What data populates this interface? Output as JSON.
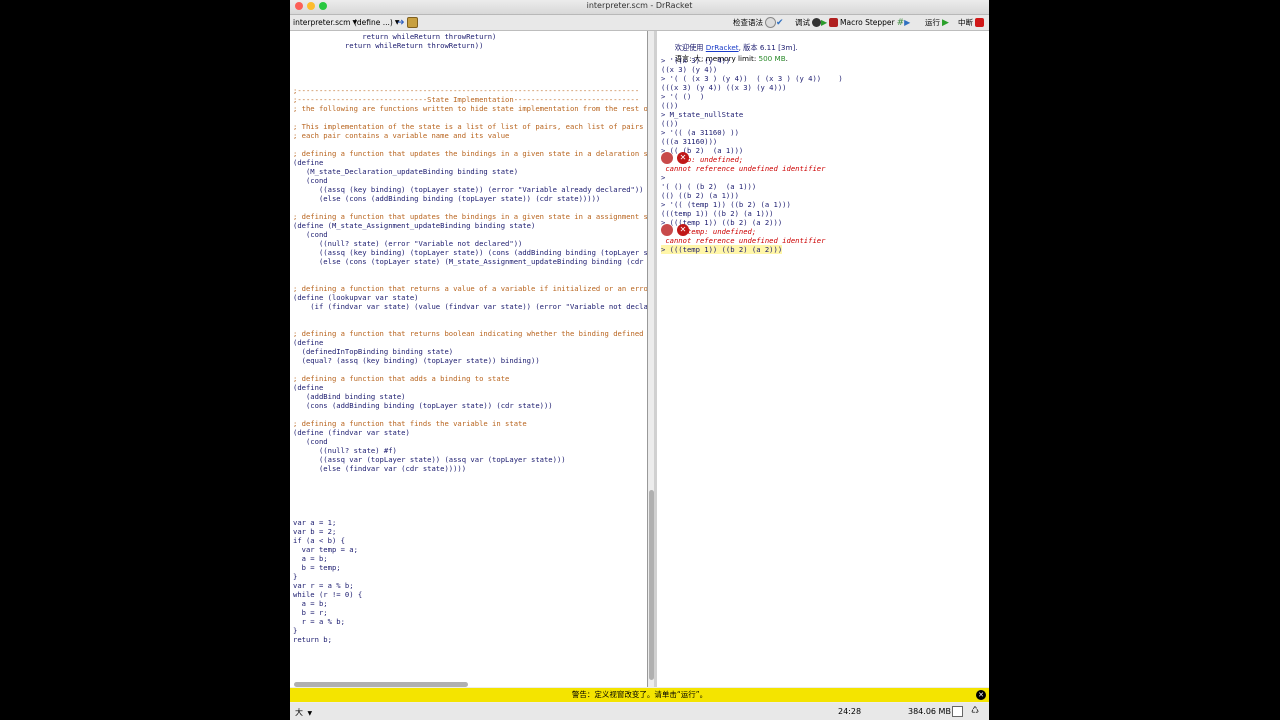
{
  "window": {
    "title": "interpreter.scm - DrRacket"
  },
  "toolbar": {
    "file_menu": "interpreter.scm",
    "define_menu": "(define ...)",
    "check_syntax": "检查语法",
    "debug": "调试",
    "macro_stepper": "Macro Stepper",
    "run": "运行",
    "stop": "中断"
  },
  "editor": {
    "lines": [
      {
        "t": "                return whileReturn throwReturn)",
        "c": "kw"
      },
      {
        "t": "            return whileReturn throwReturn))",
        "c": "kw"
      },
      {
        "t": "",
        "c": "kw"
      },
      {
        "t": "",
        "c": "kw"
      },
      {
        "t": "",
        "c": "kw"
      },
      {
        "t": "",
        "c": "kw"
      },
      {
        "t": ";-------------------------------------------------------------------------------",
        "c": "cm"
      },
      {
        "t": ";------------------------------State Implementation-----------------------------",
        "c": "cm"
      },
      {
        "t": "; the following are functions written to hide state implementation from the rest of",
        "c": "cm"
      },
      {
        "t": "",
        "c": "kw"
      },
      {
        "t": "; This implementation of the state is a list of list of pairs, each list of pairs i",
        "c": "cm"
      },
      {
        "t": "; each pair contains a variable name and its value",
        "c": "cm"
      },
      {
        "t": "",
        "c": "kw"
      },
      {
        "t": "; defining a function that updates the bindings in a given state in a delaration st",
        "c": "cm"
      },
      {
        "t": "(define",
        "c": "kw"
      },
      {
        "t": "   (M_state_Declaration_updateBinding binding state)",
        "c": "kw"
      },
      {
        "t": "   (cond",
        "c": "kw"
      },
      {
        "t": "      ((assq (key binding) (topLayer state)) (error \"Variable already declared\"))",
        "c": "kw"
      },
      {
        "t": "      (else (cons (addBinding binding (topLayer state)) (cdr state)))))",
        "c": "kw"
      },
      {
        "t": "",
        "c": "kw"
      },
      {
        "t": "; defining a function that updates the bindings in a given state in a assignment st",
        "c": "cm"
      },
      {
        "t": "(define (M_state_Assignment_updateBinding binding state)",
        "c": "kw"
      },
      {
        "t": "   (cond",
        "c": "kw"
      },
      {
        "t": "      ((null? state) (error \"Variable not declared\"))",
        "c": "kw"
      },
      {
        "t": "      ((assq (key binding) (topLayer state)) (cons (addBinding binding (topLayer s",
        "c": "kw"
      },
      {
        "t": "      (else (cons (topLayer state) (M_state_Assignment_updateBinding binding (cdr",
        "c": "kw"
      },
      {
        "t": "",
        "c": "kw"
      },
      {
        "t": "",
        "c": "kw"
      },
      {
        "t": "; defining a function that returns a value of a variable if initialized or an error",
        "c": "cm"
      },
      {
        "t": "(define (lookupvar var state)",
        "c": "kw"
      },
      {
        "t": "    (if (findvar var state) (value (findvar var state)) (error \"Variable not decla",
        "c": "kw"
      },
      {
        "t": "",
        "c": "kw"
      },
      {
        "t": "",
        "c": "kw"
      },
      {
        "t": "; defining a function that returns boolean indicating whether the binding defined i",
        "c": "cm"
      },
      {
        "t": "(define",
        "c": "kw"
      },
      {
        "t": "  (definedInTopBinding binding state)",
        "c": "kw"
      },
      {
        "t": "  (equal? (assq (key binding) (topLayer state)) binding))",
        "c": "kw"
      },
      {
        "t": "",
        "c": "kw"
      },
      {
        "t": "; defining a function that adds a binding to state",
        "c": "cm"
      },
      {
        "t": "(define",
        "c": "kw"
      },
      {
        "t": "   (addBind binding state)",
        "c": "kw"
      },
      {
        "t": "   (cons (addBinding binding (topLayer state)) (cdr state)))",
        "c": "kw"
      },
      {
        "t": "",
        "c": "kw"
      },
      {
        "t": "; defining a function that finds the variable in state",
        "c": "cm"
      },
      {
        "t": "(define (findvar var state)",
        "c": "kw"
      },
      {
        "t": "   (cond",
        "c": "kw"
      },
      {
        "t": "      ((null? state) #f)",
        "c": "kw"
      },
      {
        "t": "      ((assq var (topLayer state)) (assq var (topLayer state)))",
        "c": "kw"
      },
      {
        "t": "      (else (findvar var (cdr state)))))",
        "c": "kw"
      },
      {
        "t": "",
        "c": "kw"
      },
      {
        "t": "",
        "c": "kw"
      },
      {
        "t": "",
        "c": "kw"
      },
      {
        "t": "",
        "c": "kw"
      },
      {
        "t": "",
        "c": "kw"
      },
      {
        "t": "var a = 1;",
        "c": "kw"
      },
      {
        "t": "var b = 2;",
        "c": "kw"
      },
      {
        "t": "if (a < b) {",
        "c": "kw"
      },
      {
        "t": "  var temp = a;",
        "c": "kw"
      },
      {
        "t": "  a = b;",
        "c": "kw"
      },
      {
        "t": "  b = temp;",
        "c": "kw"
      },
      {
        "t": "}",
        "c": "kw"
      },
      {
        "t": "var r = a % b;",
        "c": "kw"
      },
      {
        "t": "while (r != 0) {",
        "c": "kw"
      },
      {
        "t": "  a = b;",
        "c": "kw"
      },
      {
        "t": "  b = r;",
        "c": "kw"
      },
      {
        "t": "  r = a % b;",
        "c": "kw"
      },
      {
        "t": "}",
        "c": "kw"
      },
      {
        "t": "return b;",
        "c": "kw"
      }
    ]
  },
  "repl": {
    "welcome_prefix": "欢迎使用 ",
    "welcome_link": "DrRacket",
    "welcome_suffix": ", 版本 6.11 [3m].",
    "language_prefix": "语言: 大; memory limit: ",
    "memory_limit": "500 MB",
    "language_suffix": ".",
    "lines": [
      {
        "t": "> '((x 3) (y 4))",
        "kind": "in"
      },
      {
        "t": "((x 3) (y 4))",
        "kind": "out"
      },
      {
        "t": "> '( ( (x 3 ) (y 4))  ( (x 3 ) (y 4))    )",
        "kind": "in"
      },
      {
        "t": "(((x 3) (y 4)) ((x 3) (y 4)))",
        "kind": "out"
      },
      {
        "t": "> '( ()  )",
        "kind": "in"
      },
      {
        "t": "(())",
        "kind": "out"
      },
      {
        "t": "> M_state_nullState",
        "kind": "in"
      },
      {
        "t": "(())",
        "kind": "out"
      },
      {
        "t": "> '(( (a 31160) ))",
        "kind": "in"
      },
      {
        "t": "(((a 31160)))",
        "kind": "out"
      },
      {
        "t": "> (( (b 2)  (a 1)))",
        "kind": "in"
      },
      {
        "t": "      b: undefined;",
        "kind": "err"
      },
      {
        "t": " cannot reference undefined identifier",
        "kind": "err"
      },
      {
        "t": ">",
        "kind": "in"
      },
      {
        "t": "'( () ( (b 2)  (a 1)))",
        "kind": "in"
      },
      {
        "t": "(() ((b 2) (a 1)))",
        "kind": "out"
      },
      {
        "t": "> '(( (temp 1)) ((b 2) (a 1)))",
        "kind": "in"
      },
      {
        "t": "(((temp 1)) ((b 2) (a 1)))",
        "kind": "out"
      },
      {
        "t": "> (((temp 1)) ((b 2) (a 2)))",
        "kind": "in"
      },
      {
        "t": "      temp: undefined;",
        "kind": "err"
      },
      {
        "t": " cannot reference undefined identifier",
        "kind": "err"
      },
      {
        "t": "> (((temp 1)) ((b 2) (a 2)))",
        "kind": "cur"
      }
    ]
  },
  "warning": {
    "text": "警告：定义视窗改变了。请单击“运行”。"
  },
  "status": {
    "language": "大",
    "position": "24:28",
    "memory": "384.06 MB"
  }
}
